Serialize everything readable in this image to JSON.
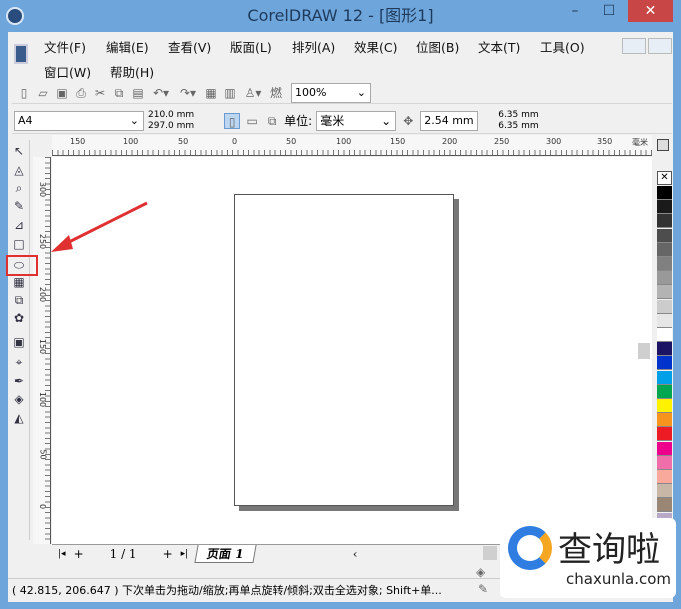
{
  "window": {
    "title": "CorelDRAW 12 - [图形1]",
    "minimize": "–",
    "maximize": "☐",
    "close": "✕"
  },
  "menu": [
    "文件(F)",
    "编辑(E)",
    "查看(V)",
    "版面(L)",
    "排列(A)",
    "效果(C)",
    "位图(B)",
    "文本(T)",
    "工具(O)",
    "窗口(W)",
    "帮助(H)"
  ],
  "toolbar": {
    "zoom": "100%"
  },
  "propbar": {
    "page_size": "A4",
    "width": "210.0 mm",
    "height": "297.0 mm",
    "unit_label": "单位:",
    "unit": "毫米",
    "nudge": "2.54 mm",
    "dup_x": "6.35 mm",
    "dup_y": "6.35 mm"
  },
  "ruler": {
    "h_labels": [
      "150",
      "100",
      "50",
      "0",
      "50",
      "100",
      "150",
      "200",
      "250",
      "300",
      "350"
    ],
    "h_unit": "毫米",
    "v_labels": [
      "300",
      "250",
      "200",
      "150",
      "100",
      "50",
      "0"
    ]
  },
  "pages": {
    "counter": "1 / 1",
    "tab": "页面 1"
  },
  "status": {
    "coords": "( 42.815, 206.647 )",
    "message": "下次单击为拖动/缩放;再单点旋转/倾斜;双击全选对象; Shift+单..."
  },
  "watermark": {
    "brand": "查询啦",
    "domain": "chaxunla.com"
  },
  "palette": [
    "#ffffff",
    "#000000",
    "#1a1a1a",
    "#333333",
    "#4d4d4d",
    "#666666",
    "#808080",
    "#999999",
    "#b3b3b3",
    "#cccccc",
    "#e6e6e6",
    "#ffffff",
    "#1b1464",
    "#0033cc",
    "#00a0e9",
    "#00a650",
    "#fff200",
    "#f7941d",
    "#ed1c24",
    "#ec008c",
    "#f06eaa",
    "#f9a99b",
    "#c8b7a6",
    "#998675",
    "#b8a9c9",
    "#8c6fb0"
  ],
  "accent": "#e03030"
}
